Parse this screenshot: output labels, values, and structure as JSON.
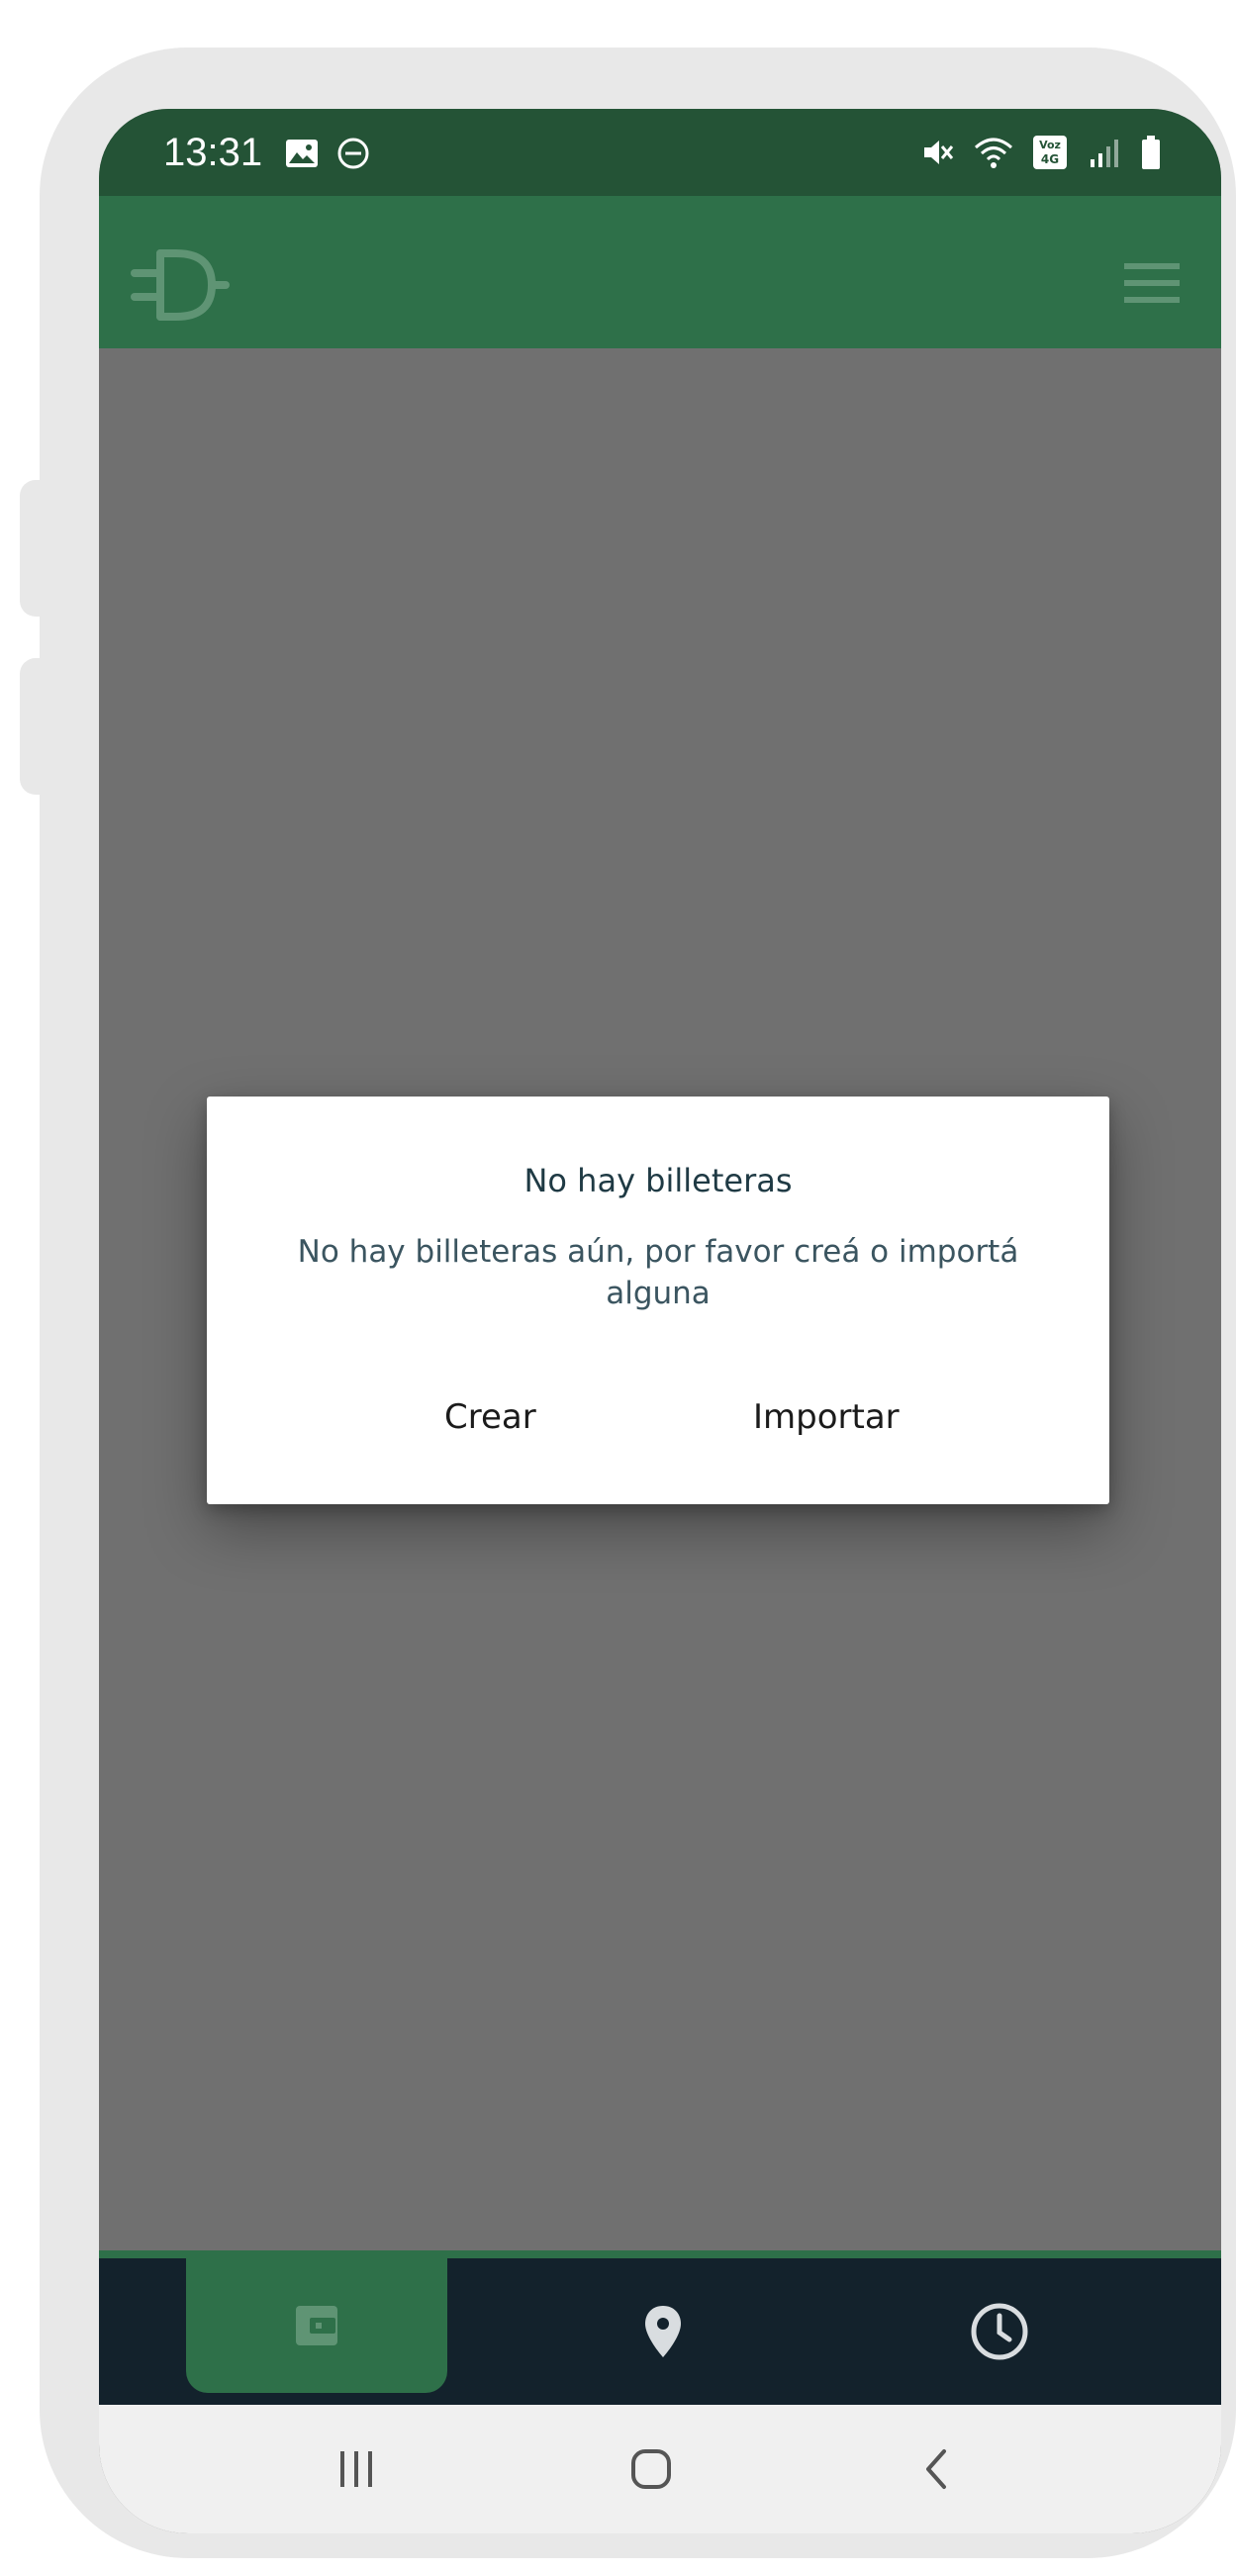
{
  "status_bar": {
    "time": "13:31",
    "network_label_top": "Voz",
    "network_label_bottom": "4G"
  },
  "app_bar": {
    "logo_icon": "d-logo-icon",
    "menu_icon": "hamburger-menu-icon"
  },
  "dialog": {
    "title": "No hay billeteras",
    "message": "No hay billeteras aún, por favor creá o importá alguna",
    "create_label": "Crear",
    "import_label": "Importar"
  },
  "bottom_nav": {
    "tabs": [
      {
        "icon": "wallet-icon",
        "selected": true
      },
      {
        "icon": "location-pin-icon",
        "selected": false
      },
      {
        "icon": "clock-icon",
        "selected": false
      }
    ]
  },
  "system_nav": {
    "recent_icon": "recent-apps-icon",
    "home_icon": "home-icon",
    "back_icon": "back-icon"
  },
  "colors": {
    "status_bar": "#245336",
    "app_bar": "#2e7049",
    "overlay": "#707070",
    "bottom_nav": "#13222c",
    "selected_tab": "#2e7049",
    "system_nav": "#f0f0f0"
  }
}
